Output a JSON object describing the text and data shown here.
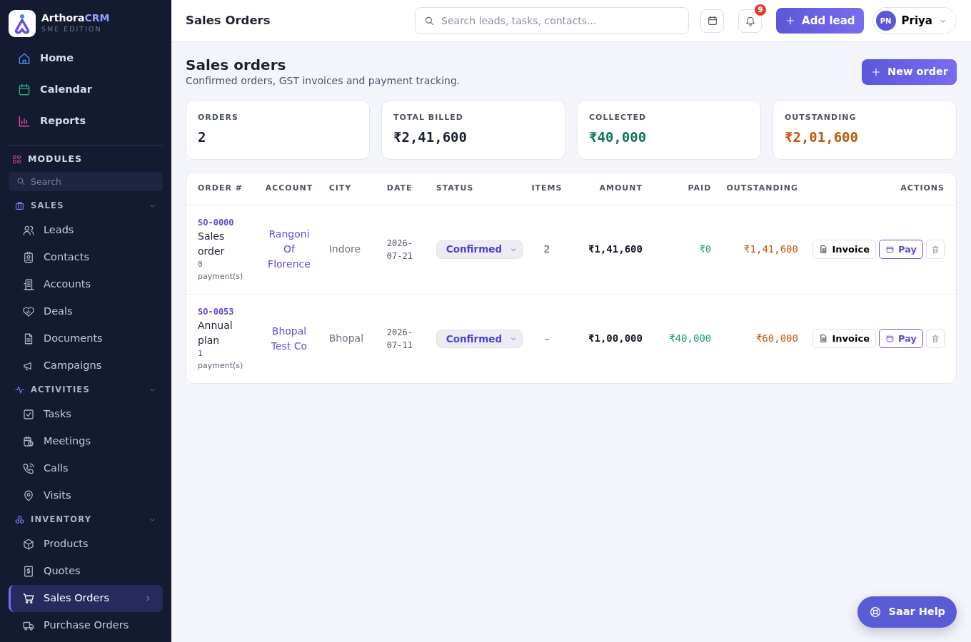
{
  "brand": {
    "name": "Arthora",
    "accent": "CRM",
    "edition": "SME EDITION"
  },
  "top_nav": [
    {
      "label": "Home",
      "selected": false
    },
    {
      "label": "Calendar",
      "selected": false
    },
    {
      "label": "Reports",
      "selected": false
    }
  ],
  "modules": {
    "title": "MODULES",
    "search_placeholder": "Search"
  },
  "groups": [
    {
      "title": "SALES",
      "expanded": true,
      "items": [
        {
          "label": "Leads",
          "selected": false
        },
        {
          "label": "Contacts",
          "selected": false
        },
        {
          "label": "Accounts",
          "selected": false
        },
        {
          "label": "Deals",
          "selected": false
        },
        {
          "label": "Documents",
          "selected": false
        },
        {
          "label": "Campaigns",
          "selected": false
        }
      ]
    },
    {
      "title": "ACTIVITIES",
      "expanded": true,
      "items": [
        {
          "label": "Tasks",
          "selected": false
        },
        {
          "label": "Meetings",
          "selected": false
        },
        {
          "label": "Calls",
          "selected": false
        },
        {
          "label": "Visits",
          "selected": false
        }
      ]
    },
    {
      "title": "INVENTORY",
      "expanded": true,
      "items": [
        {
          "label": "Products",
          "selected": false
        },
        {
          "label": "Quotes",
          "selected": false
        },
        {
          "label": "Sales Orders",
          "selected": true
        },
        {
          "label": "Purchase Orders",
          "selected": false
        }
      ]
    }
  ],
  "header": {
    "title": "Sales Orders",
    "search_placeholder": "Search leads, tasks, contacts...",
    "notification_count": "9",
    "add_button": "Add lead",
    "user": {
      "initials": "PN",
      "name": "Priya"
    }
  },
  "page": {
    "title": "Sales orders",
    "subtitle": "Confirmed orders, GST invoices and payment tracking.",
    "new_button": "New order"
  },
  "stats": [
    {
      "label": "ORDERS",
      "value": "2",
      "kind": "neutral"
    },
    {
      "label": "TOTAL BILLED",
      "value": "₹2,41,600",
      "kind": "neutral"
    },
    {
      "label": "COLLECTED",
      "value": "₹40,000",
      "kind": "success"
    },
    {
      "label": "OUTSTANDING",
      "value": "₹2,01,600",
      "kind": "warning"
    }
  ],
  "table": {
    "columns": [
      "ORDER #",
      "ACCOUNT",
      "CITY",
      "DATE",
      "STATUS",
      "ITEMS",
      "AMOUNT",
      "PAID",
      "OUTSTANDING",
      "ACTIONS"
    ],
    "rows": [
      {
        "order_no": "SO-0000",
        "title": "Sales order",
        "payment_count": "0",
        "payment_label": "payment(s)",
        "account": "Rangoni Of Florence",
        "city": "Indore",
        "date": "2026-07-21",
        "status": "Confirmed",
        "items": "2",
        "amount": "₹1,41,600",
        "paid": "₹0",
        "outstanding": "₹1,41,600",
        "actions": [
          "Invoice",
          "Pay"
        ]
      },
      {
        "order_no": "SO-0053",
        "title": "Annual plan",
        "payment_count": "1",
        "payment_label": "payment(s)",
        "account": "Bhopal Test Co",
        "city": "Bhopal",
        "date": "2026-07-11",
        "status": "Confirmed",
        "items": "–",
        "amount": "₹1,00,000",
        "paid": "₹40,000",
        "outstanding": "₹60,000",
        "actions": [
          "Invoice",
          "Pay"
        ]
      }
    ]
  },
  "help_button": "Saar Help"
}
